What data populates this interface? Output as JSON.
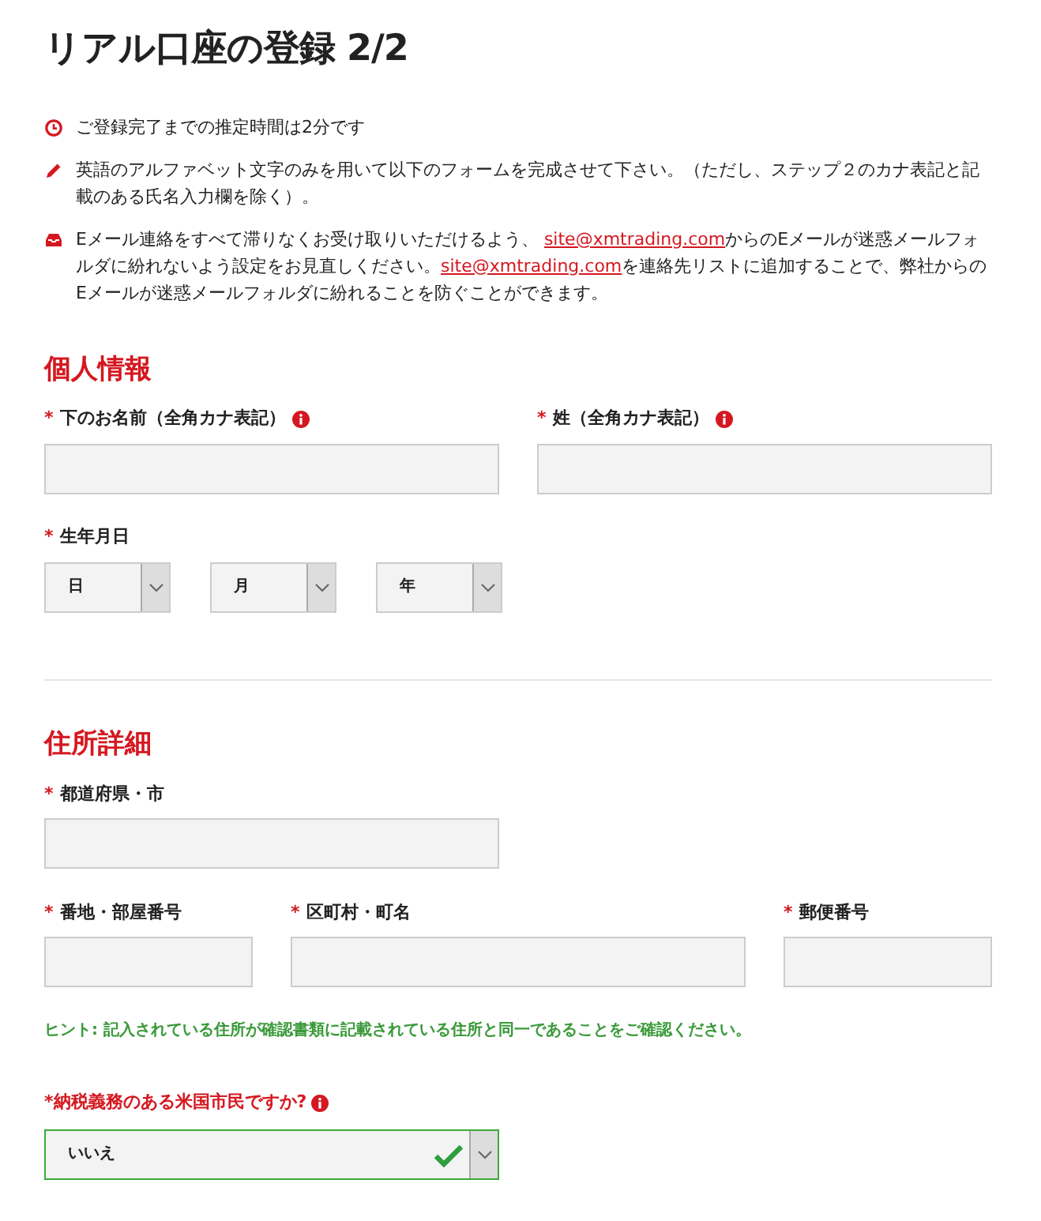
{
  "title": "リアル口座の登録 2/2",
  "notes": [
    {
      "kind": "clock",
      "parts": [
        {
          "text": "ご登録完了までの推定時間は2分です",
          "link": false
        }
      ]
    },
    {
      "kind": "pencil",
      "parts": [
        {
          "text": "英語のアルファベット文字のみを用いて以下のフォームを完成させて下さい。（ただし、ステップ２のカナ表記と記載のある氏名入力欄を除く）。",
          "link": false
        }
      ]
    },
    {
      "kind": "mail",
      "parts": [
        {
          "text": "Eメール連絡をすべて滞りなくお受け取りいただけるよう、 ",
          "link": false
        },
        {
          "text": "site@xmtrading.com",
          "link": true
        },
        {
          "text": "からのEメールが迷惑メールフォルダに紛れないよう設定をお見直しください。",
          "link": false
        },
        {
          "text": "site@xmtrading.com",
          "link": true
        },
        {
          "text": "を連絡先リストに追加することで、弊社からのEメールが迷惑メールフォルダに紛れることを防ぐことができます。",
          "link": false
        }
      ]
    }
  ],
  "sections": [
    {
      "heading": "個人情報",
      "rows": [
        [
          {
            "kind": "text",
            "mark": "*",
            "label": "下のお名前（全角カナ表記）",
            "info": true
          },
          {
            "kind": "text",
            "mark": "*",
            "label": "姓（全角カナ表記）",
            "info": true
          }
        ],
        [
          {
            "kind": "date",
            "mark": "*",
            "label": "生年月日",
            "selects": [
              "日",
              "月",
              "年"
            ]
          }
        ]
      ]
    },
    {
      "heading": "住所詳細",
      "rows": [
        [
          {
            "kind": "text",
            "mark": "*",
            "label": "都道府県・市"
          }
        ],
        [
          {
            "kind": "text",
            "mark": "*",
            "label": "番地・部屋番号"
          },
          {
            "kind": "text",
            "mark": "*",
            "label": "区町村・町名"
          },
          {
            "kind": "text",
            "mark": "*",
            "label": "郵便番号"
          }
        ]
      ],
      "hint": "ヒント: 記入されている住所が確認書類に記載されている住所と同一であることをご確認ください。",
      "question": {
        "label": "*納税義務のある米国市民ですか?",
        "info": true,
        "value": "いいえ",
        "valid": true
      }
    }
  ]
}
